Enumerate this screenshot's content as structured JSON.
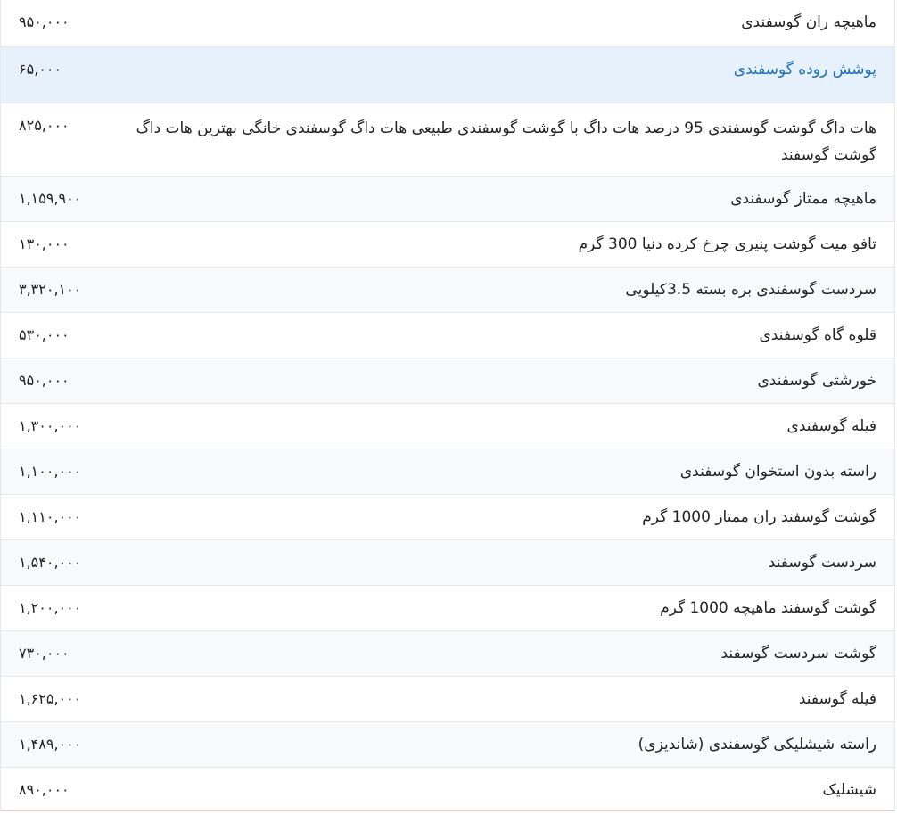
{
  "rows": [
    {
      "name": "ماهیچه ران گوسفندی",
      "price": "۹۵۰,۰۰۰"
    },
    {
      "name": "پوشش روده گوسفندی",
      "price": "۶۵,۰۰۰"
    },
    {
      "name": "هات داگ گوشت گوسفندی 95 درصد هات داگ با گوشت گوسفندی طبیعی هات داگ گوسفندی خانگی بهترین هات داگ گوشت گوسفند",
      "price": "۸۲۵,۰۰۰"
    },
    {
      "name": "ماهیچه ممتاز گوسفندی",
      "price": "۱,۱۵۹,۹۰۰"
    },
    {
      "name": "تافو میت گوشت پنیری چرخ کرده دنیا 300 گرم",
      "price": "۱۳۰,۰۰۰"
    },
    {
      "name": "سردست گوسفندی بره بسته 3.5کیلویی",
      "price": "۳,۳۲۰,۱۰۰"
    },
    {
      "name": "قلوه گاه گوسفندی",
      "price": "۵۳۰,۰۰۰"
    },
    {
      "name": "خورشتی گوسفندی",
      "price": "۹۵۰,۰۰۰"
    },
    {
      "name": "فیله گوسفندی",
      "price": "۱,۳۰۰,۰۰۰"
    },
    {
      "name": "راسته بدون استخوان گوسفندی",
      "price": "۱,۱۰۰,۰۰۰"
    },
    {
      "name": "گوشت گوسفند ران ممتاز 1000 گرم",
      "price": "۱,۱۱۰,۰۰۰"
    },
    {
      "name": "سردست گوسفند",
      "price": "۱,۵۴۰,۰۰۰"
    },
    {
      "name": "گوشت گوسفند ماهیچه 1000 گرم",
      "price": "۱,۲۰۰,۰۰۰"
    },
    {
      "name": "گوشت سردست گوسفند",
      "price": "۷۳۰,۰۰۰"
    },
    {
      "name": "فیله گوسفند",
      "price": "۱,۶۲۵,۰۰۰"
    },
    {
      "name": "راسته شیشلیکی گوسفندی (شاندیزی)",
      "price": "۱,۴۸۹,۰۰۰"
    },
    {
      "name": "شیشلیک",
      "price": "۸۹۰,۰۰۰"
    }
  ]
}
